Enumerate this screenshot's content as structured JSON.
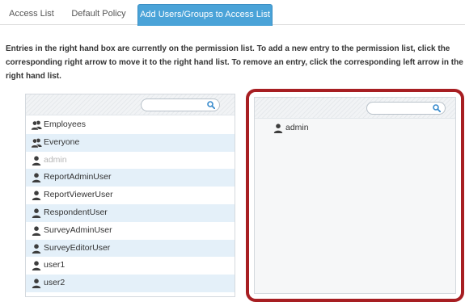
{
  "tabs": [
    {
      "label": "Access List",
      "active": false
    },
    {
      "label": "Default Policy",
      "active": false
    },
    {
      "label": "Add Users/Groups to Access List",
      "active": true
    }
  ],
  "instructions": [
    "Entries in the right hand box are currently on the permission list. To add a new entry to the permission list, click the",
    "corresponding right arrow to move it to the right hand list. To remove an entry, click the corresponding left arrow in the",
    "right hand list."
  ],
  "available_list": {
    "search_placeholder": "",
    "items": [
      {
        "label": "Employees",
        "type": "group",
        "disabled": false
      },
      {
        "label": "Everyone",
        "type": "group",
        "disabled": false
      },
      {
        "label": "admin",
        "type": "user",
        "disabled": true
      },
      {
        "label": "ReportAdminUser",
        "type": "user",
        "disabled": false
      },
      {
        "label": "ReportViewerUser",
        "type": "user",
        "disabled": false
      },
      {
        "label": "RespondentUser",
        "type": "user",
        "disabled": false
      },
      {
        "label": "SurveyAdminUser",
        "type": "user",
        "disabled": false
      },
      {
        "label": "SurveyEditorUser",
        "type": "user",
        "disabled": false
      },
      {
        "label": "user1",
        "type": "user",
        "disabled": false
      },
      {
        "label": "user2",
        "type": "user",
        "disabled": false
      }
    ]
  },
  "permission_list": {
    "search_placeholder": "",
    "items": [
      {
        "label": "admin",
        "type": "user"
      }
    ]
  },
  "colors": {
    "active_tab": "#4aa3d8",
    "row_highlight": "#e4f0f9",
    "highlight_frame": "#a71e22",
    "search_icon": "#3a8ccd"
  }
}
